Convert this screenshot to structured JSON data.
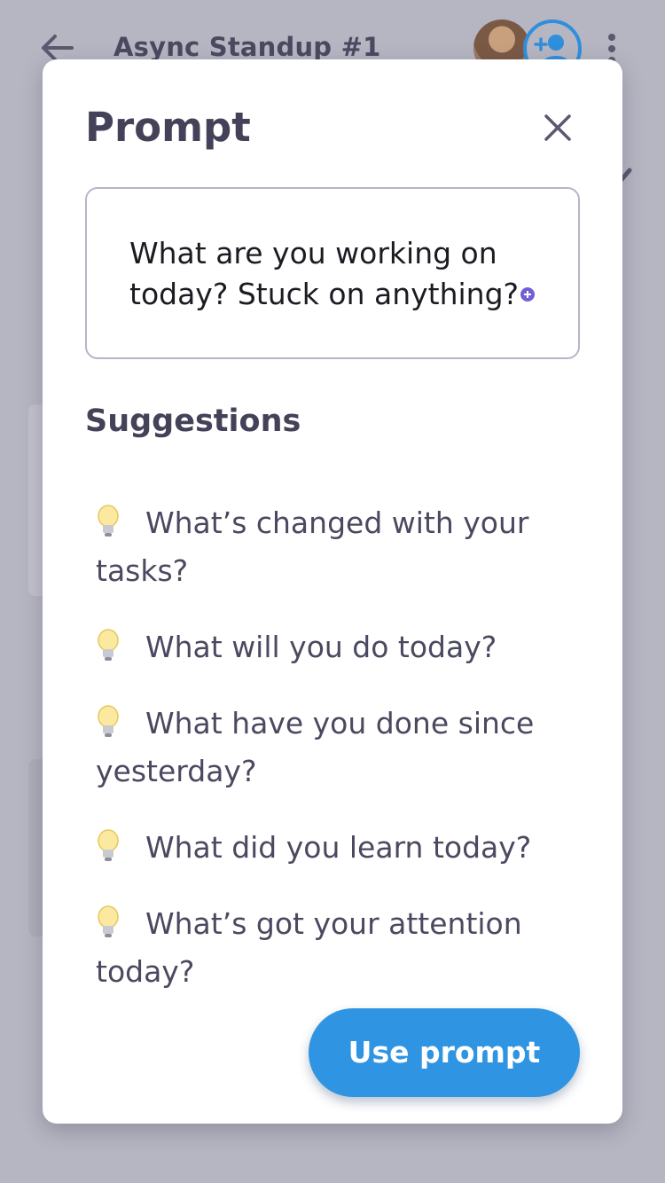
{
  "background": {
    "title": "Async Standup #1"
  },
  "modal": {
    "title": "Prompt",
    "prompt_text": "What are you working on today? Stuck on anything?",
    "suggestions_heading": "Suggestions",
    "suggestions": [
      "What’s changed with your tasks?",
      "What will you do today?",
      "What have you done since yesterday?",
      "What did you learn today?",
      "What’s got your attention today?"
    ],
    "use_button_label": "Use prompt"
  },
  "colors": {
    "accent": "#2f95e2",
    "text": "#444258",
    "overlay": "#b6b5c2"
  }
}
